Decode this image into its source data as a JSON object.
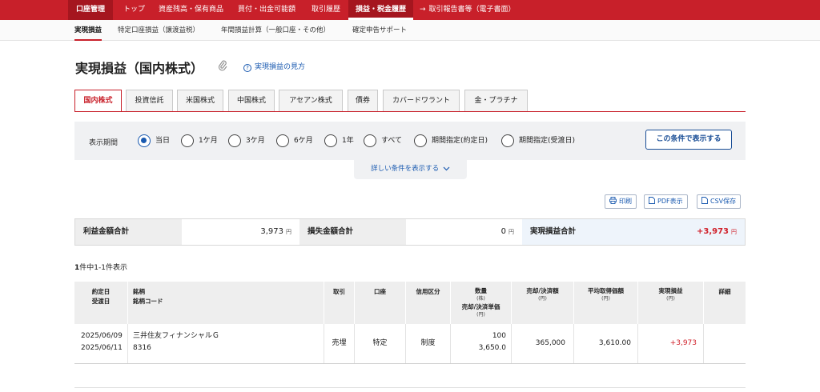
{
  "topnav": {
    "items": [
      "口座管理",
      "トップ",
      "資産残高・保有商品",
      "買付・出金可能額",
      "取引履歴",
      "損益・税金履歴",
      "取引報告書等（電子書面）"
    ]
  },
  "subnav": {
    "items": [
      "実現損益",
      "特定口座損益（譲渡益税）",
      "年間損益計算（一般口座・その他）",
      "確定申告サポート"
    ]
  },
  "page": {
    "title": "実現損益（国内株式）",
    "help_link": "実現損益の見方",
    "help_icon_glyph": "?"
  },
  "tabs": [
    "国内株式",
    "投資信託",
    "米国株式",
    "中国株式",
    "アセアン株式",
    "債券",
    "カバードワラント",
    "金・プラチナ"
  ],
  "filter": {
    "label": "表示期間",
    "options": [
      "当日",
      "1ケ月",
      "3ケ月",
      "6ケ月",
      "1年",
      "すべて",
      "期間指定(約定日)",
      "期間指定(受渡日)"
    ],
    "selected": "当日",
    "submit": "この条件で表示する",
    "more": "詳しい条件を表示する"
  },
  "actions": {
    "print": "印刷",
    "pdf": "PDF表示",
    "csv": "CSV保存"
  },
  "summary": {
    "profit_label": "利益金額合計",
    "profit_value": "3,973",
    "loss_label": "損失金額合計",
    "loss_value": "0",
    "realized_label": "実現損益合計",
    "realized_value": "+3,973",
    "unit": "円"
  },
  "count": {
    "total": "1",
    "text": "件中1-1件表示"
  },
  "table": {
    "headers": {
      "date1": "約定日",
      "date2": "受渡日",
      "name1": "銘柄",
      "name2": "銘柄コード",
      "trade": "取引",
      "account": "口座",
      "credit": "信用区分",
      "qty": "数量",
      "qty_unit": "(株)",
      "price": "売却/決済単価",
      "price_unit": "(円)",
      "amount": "売却/決済額",
      "amount_unit": "(円)",
      "avgcost": "平均取得価額",
      "avgcost_unit": "(円)",
      "pl": "実現損益",
      "pl_unit": "(円)",
      "detail": "詳細"
    },
    "rows": [
      {
        "trade_date": "2025/06/09",
        "settle_date": "2025/06/11",
        "name": "三井住友フィナンシャルＧ",
        "code": "8316",
        "trade": "売埋",
        "account": "特定",
        "credit": "制度",
        "qty": "100",
        "price": "3,650.0",
        "amount": "365,000",
        "avgcost": "3,610.00",
        "pl": "+3,973"
      }
    ]
  },
  "colors": {
    "brand": "#c8202a",
    "link": "#1a5ab0",
    "positive": "#d0202a"
  }
}
